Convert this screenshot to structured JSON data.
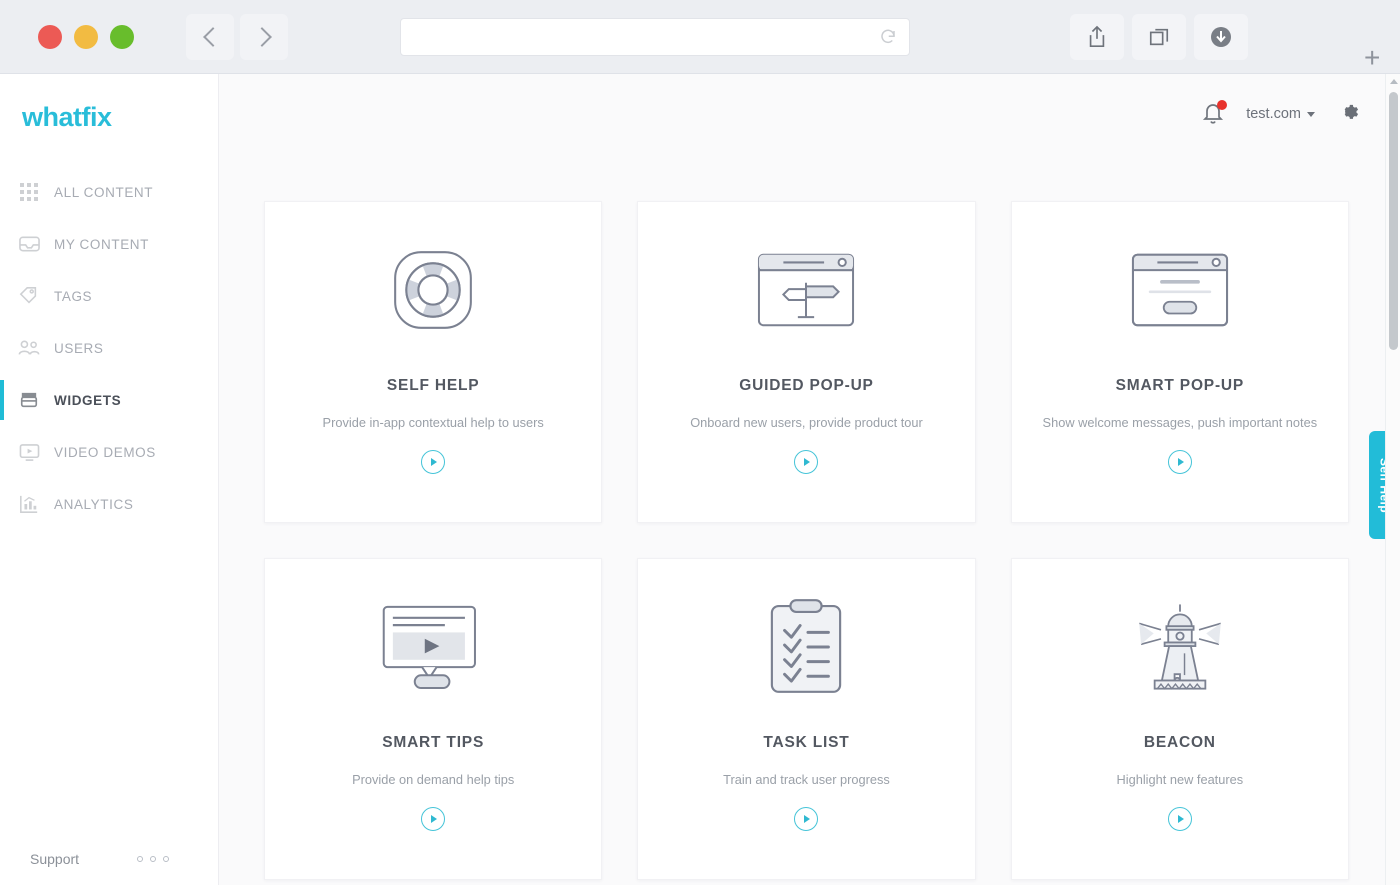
{
  "browser": {
    "traffic_lights": [
      "close",
      "minimize",
      "maximize"
    ],
    "back_label": "Back",
    "forward_label": "Forward",
    "url_value": "",
    "url_placeholder": "",
    "reload_label": "Reload",
    "share_label": "Share",
    "tabs_label": "Show tabs",
    "downloads_label": "Downloads",
    "new_tab_label": "+"
  },
  "sidebar": {
    "logo": "whatfix",
    "items": [
      {
        "label": "ALL CONTENT",
        "icon": "grid-icon",
        "active": false
      },
      {
        "label": "MY CONTENT",
        "icon": "inbox-icon",
        "active": false
      },
      {
        "label": "TAGS",
        "icon": "tag-icon",
        "active": false
      },
      {
        "label": "USERS",
        "icon": "users-icon",
        "active": false
      },
      {
        "label": "WIDGETS",
        "icon": "widgets-icon",
        "active": true
      },
      {
        "label": "VIDEO DEMOS",
        "icon": "video-icon",
        "active": false
      },
      {
        "label": "ANALYTICS",
        "icon": "analytics-icon",
        "active": false
      }
    ],
    "support_label": "Support",
    "more_label": "More options"
  },
  "header": {
    "notifications_label": "Notifications",
    "has_unread": true,
    "account": "test.com",
    "settings_label": "Settings"
  },
  "cards": [
    {
      "title": "SELF HELP",
      "desc": "Provide in-app contextual help to users",
      "icon": "lifebuoy-icon"
    },
    {
      "title": "GUIDED POP-UP",
      "desc": "Onboard new users, provide product tour",
      "icon": "signpost-window-icon"
    },
    {
      "title": "SMART POP-UP",
      "desc": "Show welcome messages, push important notes",
      "icon": "message-window-icon"
    },
    {
      "title": "SMART TIPS",
      "desc": "Provide on demand help tips",
      "icon": "tooltip-video-icon"
    },
    {
      "title": "TASK LIST",
      "desc": "Train and track user progress",
      "icon": "clipboard-checklist-icon"
    },
    {
      "title": "BEACON",
      "desc": "Highlight new features",
      "icon": "lighthouse-icon"
    }
  ],
  "widget_tab": {
    "label": "Self Help"
  },
  "colors": {
    "brand_cyan": "#29bdd9",
    "accent_tab": "#22bcd8",
    "notification_red": "#e8322c",
    "text_dark": "#535861",
    "text_muted": "#9aa0a8"
  }
}
